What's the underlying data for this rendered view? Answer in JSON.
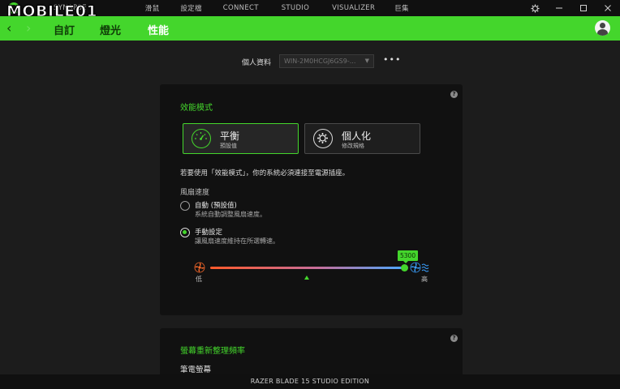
{
  "titlebar": {
    "watermark": "MOBILE01",
    "nav": [
      "SYNAPSE",
      "",
      "滑鼠",
      "設定檔",
      "CONNECT",
      "STUDIO",
      "VISUALIZER",
      "巨集"
    ]
  },
  "header": {
    "tabs": [
      "自訂",
      "燈光",
      "性能"
    ],
    "active_tab": "性能"
  },
  "profile": {
    "label": "個人資料",
    "value": "WIN-2M0HCGJ6GS9-...",
    "more": "•••"
  },
  "performance": {
    "title": "效能模式",
    "modes": [
      {
        "title": "平衡",
        "subtitle": "預設值",
        "icon": "gauge-icon",
        "active": true
      },
      {
        "title": "個人化",
        "subtitle": "修改規格",
        "icon": "gear-icon",
        "active": false
      }
    ],
    "note": "若要使用「效能模式」，你的系統必須連接至電源插座。",
    "fan_label": "風扇速度",
    "options": [
      {
        "title": "自動 (預設值)",
        "desc": "系統自動調整風扇速度。",
        "selected": false
      },
      {
        "title": "手動設定",
        "desc": "讓風扇速度維持在所選轉速。",
        "selected": true
      }
    ],
    "slider": {
      "value": 5300,
      "value_label": "5300",
      "fraction": 1.0,
      "low_label": "低",
      "high_label": "高"
    }
  },
  "refresh": {
    "title": "螢幕重新整理頻率",
    "subtitle": "筆電螢幕"
  },
  "status": {
    "device": "RAZER BLADE 15 STUDIO EDITION"
  },
  "colors": {
    "accent": "#44d62c",
    "background": "#1c1c1c",
    "card": "#111111"
  }
}
